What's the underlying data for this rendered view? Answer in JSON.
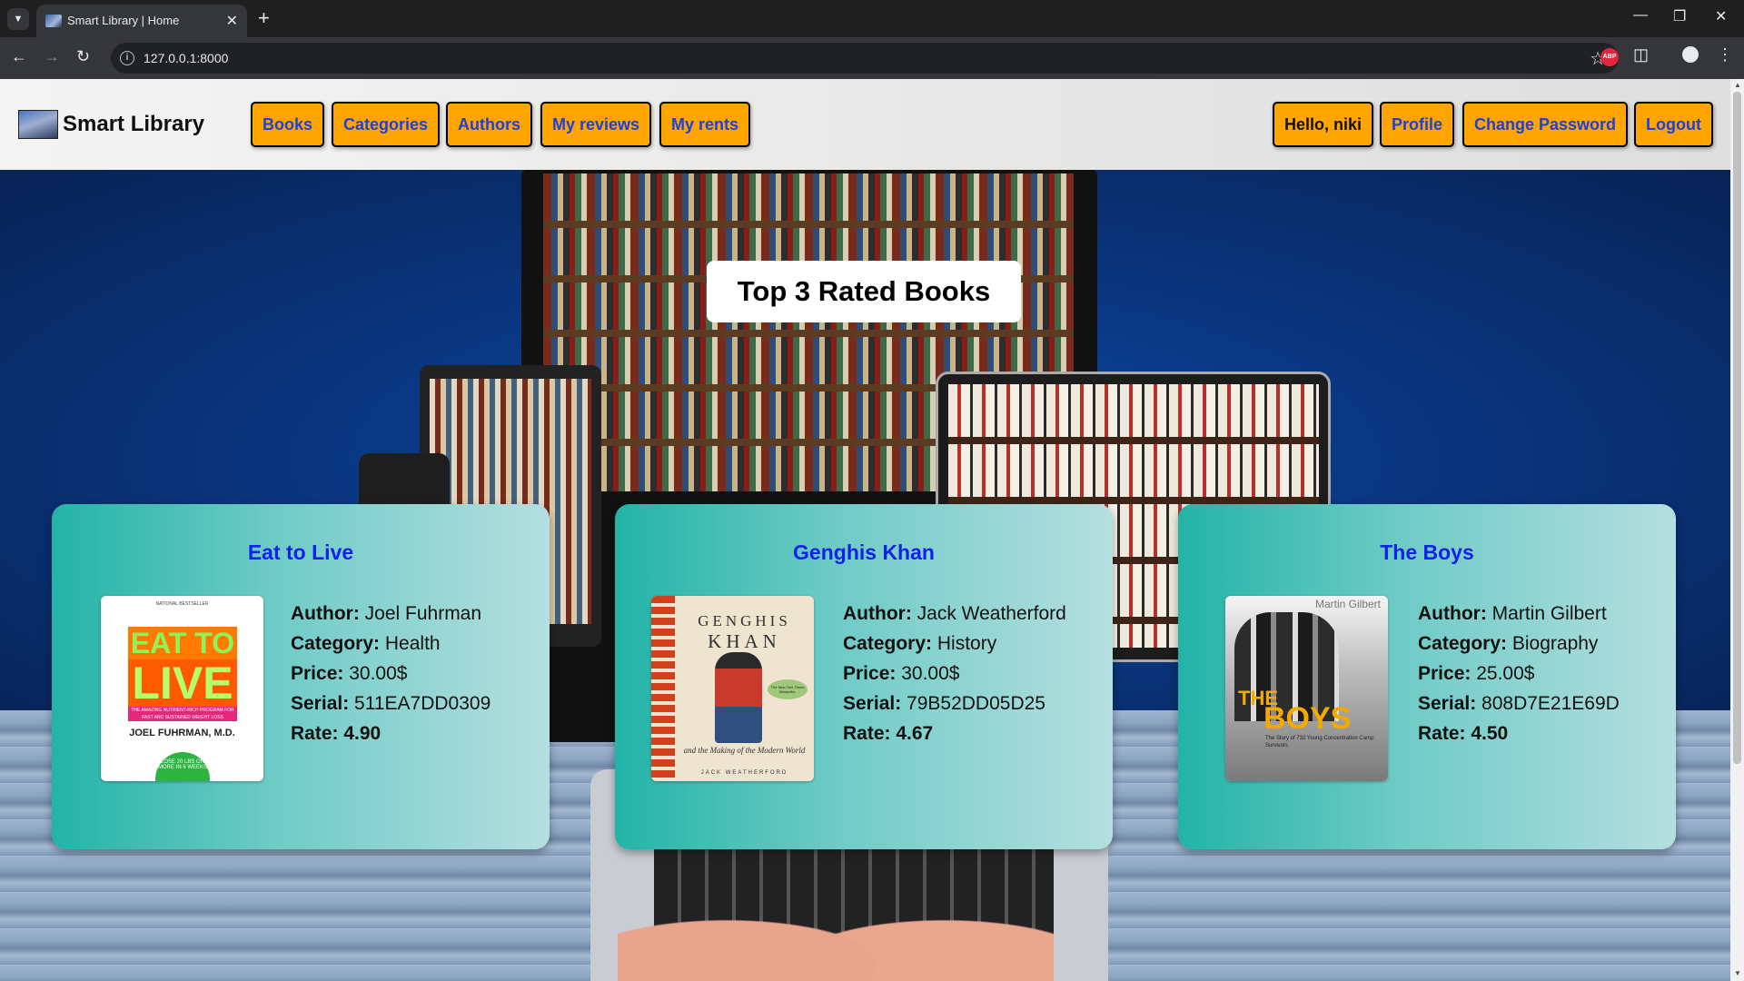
{
  "browser": {
    "tab_title": "Smart Library | Home",
    "url": "127.0.0.1:8000",
    "icons": [
      "tab-search-icon",
      "favicon-icon",
      "close-icon",
      "new-tab-icon",
      "minimize-icon",
      "maximize-icon",
      "window-close-icon",
      "back-icon",
      "forward-icon",
      "reload-icon",
      "info-icon",
      "star-icon",
      "adblock-icon",
      "extensions-icon",
      "profile-icon",
      "menu-icon"
    ],
    "adblock_label": "ABP"
  },
  "navbar": {
    "brand": "Smart Library",
    "links": [
      "Books",
      "Categories",
      "Authors",
      "My reviews",
      "My rents"
    ],
    "user_greeting": "Hello, niki",
    "user_links": [
      "Profile",
      "Change Password",
      "Logout"
    ]
  },
  "hero": {
    "heading": "Top 3 Rated Books"
  },
  "labels": {
    "author": "Author:",
    "category": "Category:",
    "price": "Price:",
    "serial": "Serial:",
    "rate": "Rate:"
  },
  "books": [
    {
      "title": "Eat to Live",
      "author": "Joel Fuhrman",
      "category": "Health",
      "price": "30.00$",
      "serial": "511EA7DD0309",
      "rate": "4.90",
      "cover": {
        "tagline": "NATIONAL BESTSELLER",
        "line1": "EAT TO",
        "line2": "LIVE",
        "band": "THE AMAZING NUTRIENT-RICH PROGRAM FOR FAST AND SUSTAINED WEIGHT LOSS",
        "author": "JOEL FUHRMAN, M.D.",
        "burst": "LOSE 20 LBS OR MORE IN 6 WEEKS"
      }
    },
    {
      "title": "Genghis Khan",
      "author": "Jack Weatherford",
      "category": "History",
      "price": "30.00$",
      "serial": "79B52DD05D25",
      "rate": "4.67",
      "cover": {
        "line1": "GENGHIS",
        "line2": "KHAN",
        "seal": "The New York Times Bestseller",
        "subtitle": "and the Making of the Modern World",
        "author": "JACK WEATHERFORD"
      }
    },
    {
      "title": "The Boys",
      "author": "Martin Gilbert",
      "category": "Biography",
      "price": "25.00$",
      "serial": "808D7E21E69D",
      "rate": "4.50",
      "cover": {
        "author": "Martin Gilbert",
        "line1": "THE",
        "line2": "BOYS",
        "subtitle": "The Story of 732 Young Concentration Camp Survivors"
      }
    }
  ]
}
